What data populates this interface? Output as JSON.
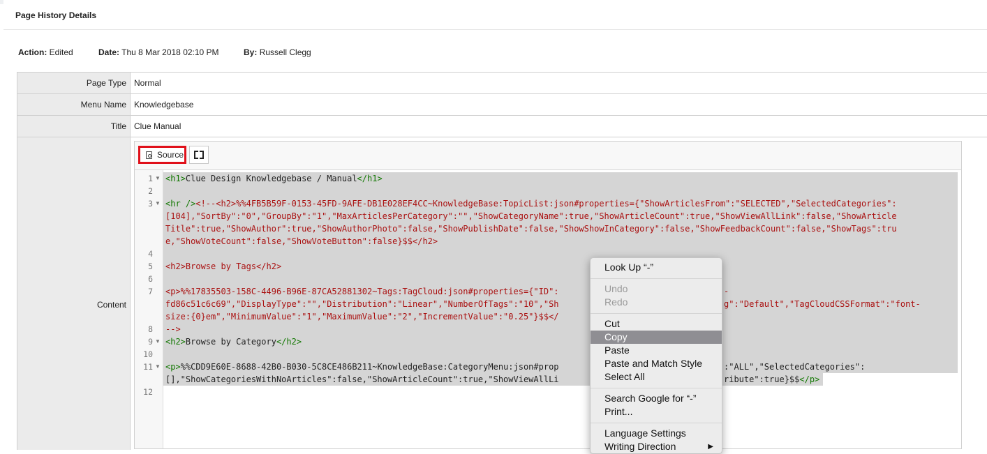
{
  "modal": {
    "title": "Page History Details"
  },
  "meta": {
    "action_label": "Action:",
    "action_value": "Edited",
    "date_label": "Date:",
    "date_value": "Thu 8 Mar 2018 02:10 PM",
    "by_label": "By:",
    "by_value": "Russell Clegg"
  },
  "rows": {
    "page_type": {
      "label": "Page Type",
      "value": "Normal"
    },
    "menu_name": {
      "label": "Menu Name",
      "value": "Knowledgebase"
    },
    "title": {
      "label": "Title",
      "value": "Clue Manual"
    },
    "content": {
      "label": "Content"
    }
  },
  "editor": {
    "source_label": "Source",
    "line_numbers": [
      "1",
      "2",
      "3",
      "4",
      "5",
      "6",
      "7",
      "8",
      "9",
      "10",
      "11",
      "12"
    ],
    "lines": {
      "l1": {
        "t1": "<h1>",
        "x1": "Clue Design Knowledgebase / Manual",
        "t2": "</h1>"
      },
      "l3a": {
        "t1": "<hr />",
        "c1": "<!--<h2>%%4FB5B59F-0153-45FD-9AFE-DB1E028EF4CC~KnowledgeBase:TopicList:json#properties={\"ShowArticlesFrom\":\"SELECTED\",\"SelectedCategories\":"
      },
      "l3b": "[104],\"SortBy\":\"0\",\"GroupBy\":\"1\",\"MaxArticlesPerCategory\":\"\",\"ShowCategoryName\":true,\"ShowArticleCount\":true,\"ShowViewAllLink\":false,\"ShowArticle",
      "l3c": "Title\":true,\"ShowAuthor\":true,\"ShowAuthorPhoto\":false,\"ShowPublishDate\":false,\"ShowShowInCategory\":false,\"ShowFeedbackCount\":false,\"ShowTags\":tru",
      "l3d": "e,\"ShowVoteCount\":false,\"ShowVoteButton\":false}$$</h2>",
      "l5": "<h2>Browse by Tags</h2>",
      "l7a": "<p>%%17835503-158C-4496-B96E-87CA52881302~Tags:TagCloud:json#properties={\"ID\":",
      "l7a2": "-",
      "l7b1": "fd86c51c6c69\",\"DisplayType\":\"\",\"Distribution\":\"Linear\",\"NumberOfTags\":\"10\",\"Sh",
      "l7b2": "g\":\"Default\",\"TagCloudCSSFormat\":\"font-",
      "l7c": "size:{0}em\",\"MinimumValue\":\"1\",\"MaximumValue\":\"2\",\"IncrementValue\":\"0.25\"}$$</",
      "l8": "-->",
      "l9": {
        "t1": "<h2>",
        "x1": "Browse by Category",
        "t2": "</h2>"
      },
      "l11a1": {
        "t1": "<p>",
        "x1": "%%CDD9E60E-8688-42B0-B030-5C8CE486B211~KnowledgeBase:CategoryMenu:json#prop"
      },
      "l11a2": ":\"ALL\",\"SelectedCategories\":",
      "l11b1": "[],\"ShowCategoriesWithNoArticles\":false,\"ShowArticleCount\":true,\"ShowViewAllLi",
      "l11b2": {
        "x1": "ribute\":true}$$",
        "t1": "</p>"
      }
    }
  },
  "context_menu": {
    "look_up": "Look Up “-”",
    "undo": "Undo",
    "redo": "Redo",
    "cut": "Cut",
    "copy": "Copy",
    "paste": "Paste",
    "paste_match": "Paste and Match Style",
    "select_all": "Select All",
    "search_google": "Search Google for “-”",
    "print": "Print...",
    "language": "Language Settings",
    "writing_direction": "Writing Direction"
  }
}
